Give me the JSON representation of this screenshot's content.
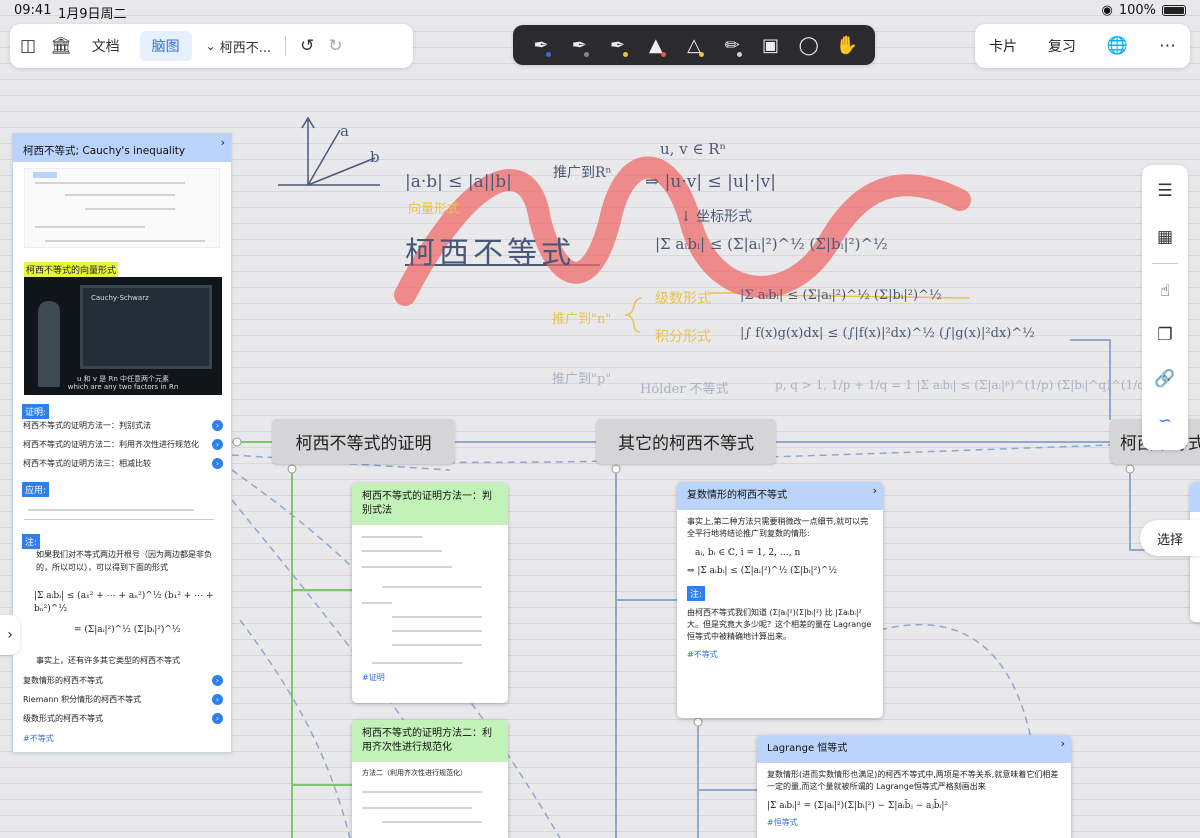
{
  "status": {
    "time": "09:41",
    "date": "1月9日周二",
    "battery": "100%"
  },
  "toolbar": {
    "doc_tab": "文档",
    "mindmap_tab": "脑图",
    "doc_title": "柯西不...",
    "card_button": "卡片",
    "review_button": "复习",
    "pen_colors": [
      "#2f6fe0",
      "#888888",
      "#f2c230",
      "#ff4d4d",
      "#f2c230",
      "#cfcfcf"
    ]
  },
  "handwriting": {
    "vec_a": "a",
    "vec_b": "b",
    "main_ineq": "|a·b| ≤ |a||b|",
    "generalize_to": "推广到Rⁿ",
    "vector_form": "向量形式",
    "uv_in_rn": "u, v ∈ Rⁿ",
    "rn_ineq": "⇒ |u·v| ≤ |u|·|v|",
    "arrow_form": "↓ 坐标形式",
    "sum_ineq": "|Σ aᵢbᵢ| ≤ (Σ|aᵢ|²)^½ (Σ|bᵢ|²)^½",
    "title_big": "柯西不等式",
    "generalize_n": "推广到\"n\"",
    "series_form": "级数形式",
    "series_ineq": "|Σ aᵢbᵢ| ≤ (Σ|aᵢ|²)^½ (Σ|bᵢ|²)^½",
    "integral_form": "积分形式",
    "integral_ineq": "|∫ f(x)g(x)dx| ≤ (∫|f(x)|²dx)^½ (∫|g(x)|²dx)^½",
    "generalize_p": "推广到\"p\"",
    "holder": "Hölder 不等式",
    "holder_ineq": "p, q > 1, 1/p + 1/q = 1 |Σ aᵢbᵢ| ≤ (Σ|aᵢ|ᵖ)^(1/p) (Σ|bᵢ|^q)^(1/q)"
  },
  "side_panel": {
    "title": "柯西不等式; Cauchy's inequality",
    "vector_form_label": "柯西不等式的向量形式",
    "video_caption_1": "u 和 v 是 Rn 中任意两个元素",
    "video_caption_2": "which are any two factors in Rn",
    "board_title": "Cauchy-Schwarz",
    "proof_label": "证明:",
    "proof_links": [
      "柯西不等式的证明方法一：判别式法",
      "柯西不等式的证明方法二：利用齐次性进行规范化",
      "柯西不等式的证明方法三：相减比较"
    ],
    "apply_label": "应用:",
    "note_label": "注:",
    "note_bullet_1": "如果我们对不等式两边开根号（因为两边都是非负的，所以可以），可以得到下面的形式",
    "note_bullet_2": "事实上，还有许多其它类型的柯西不等式",
    "other_links": [
      "复数情形的柯西不等式",
      "Riemann 积分情形的柯西不等式",
      "级数形式的柯西不等式"
    ],
    "tag": "#不等式"
  },
  "mindmap": {
    "node_proof": "柯西不等式的证明",
    "node_other": "其它的柯西不等式",
    "node_partial": "柯西不等式",
    "card1_title": "柯西不等式的证明方法一：判别式法",
    "card1_tag": "#证明",
    "card2_title": "柯西不等式的证明方法二：利用齐次性进行规范化",
    "card2_line": "方法二（利用齐次性进行规范化）",
    "card3_title": "复数情形的柯西不等式",
    "card3_body": "事实上,第二种方法只需要稍微改一点细节,就可以完全平行地将结论推广到复数的情形:",
    "card3_math1": "aᵢ, bᵢ ∈ ℂ, i = 1, 2, …, n",
    "card3_math2": "⇒ |Σ aᵢbᵢ| ≤ (Σ|aᵢ|²)^½ (Σ|bᵢ|²)^½",
    "card3_note": "注:",
    "card3_body2": "由柯西不等式我们知道 (Σ|aᵢ|²)(Σ|bᵢ|²) 比 |Σaᵢbᵢ|² 大。但是究竟大多少呢？这个相差的量在 Lagrange 恒等式中被精确地计算出来。",
    "card3_tag": "#不等式",
    "card4_title": "Lagrange 恒等式",
    "card4_body": "复数情形(进而实数情形也满足)的柯西不等式中,两项是不等关系,就意味着它们相差一定的量,而这个量就被所谓的 Lagrange恒等式严格刻画出来",
    "card4_math": "|Σ aᵢbᵢ|² = (Σ|aᵢ|²)(Σ|bᵢ|²) − Σ|aᵢb̄ⱼ − aⱼb̄ᵢ|²",
    "card4_tag": "#恒等式"
  },
  "select_button": "选择"
}
